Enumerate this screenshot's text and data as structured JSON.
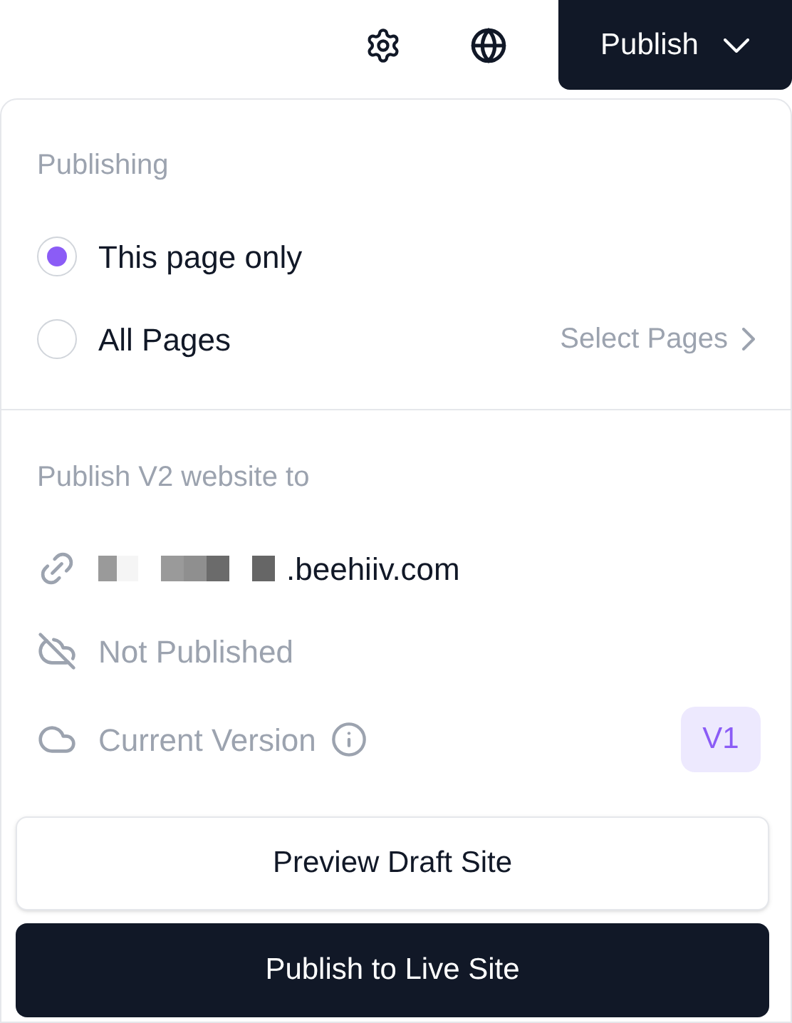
{
  "toolbar": {
    "publish_button": "Publish"
  },
  "publishing": {
    "heading": "Publishing",
    "options": [
      {
        "label": "This page only",
        "selected": true
      },
      {
        "label": "All Pages",
        "selected": false,
        "action": "Select Pages"
      }
    ]
  },
  "destination": {
    "heading": "Publish V2 website to",
    "domain": ".beehiiv.com",
    "status": "Not Published",
    "version_label": "Current Version",
    "version": "V1"
  },
  "buttons": [
    {
      "label": "Preview Draft Site",
      "kind": "secondary"
    },
    {
      "label": "Publish to Live Site",
      "kind": "primary"
    }
  ]
}
